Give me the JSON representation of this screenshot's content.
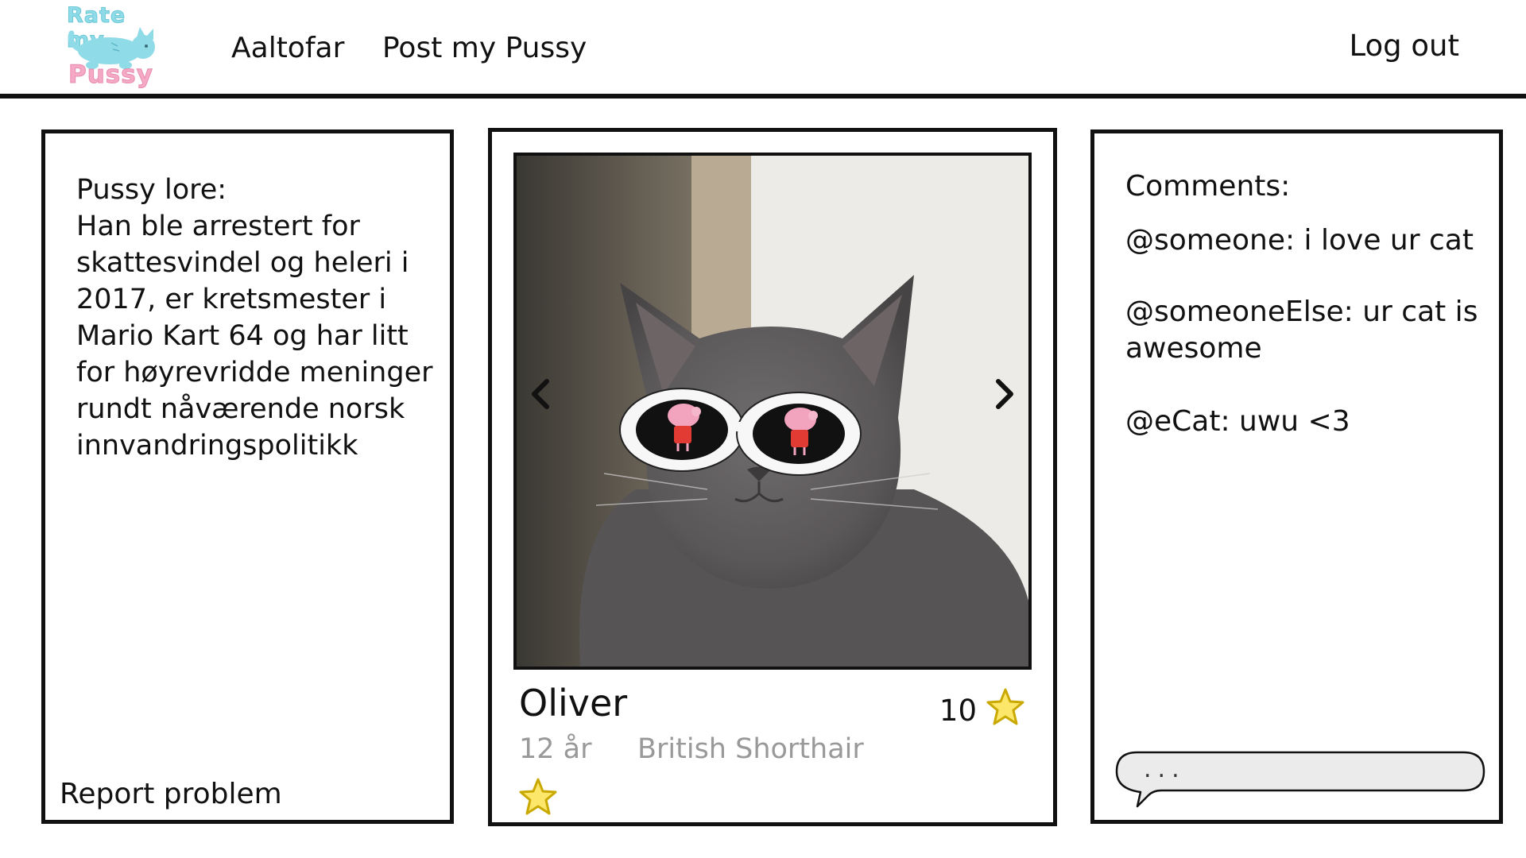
{
  "header": {
    "logo_top": "Rate my",
    "logo_bottom": "Pussy",
    "nav": [
      "Aaltofar",
      "Post my Pussy"
    ],
    "logout": "Log out"
  },
  "lore": {
    "title": "Pussy lore:",
    "text": "Han ble arrestert for skattesvindel og heleri i 2017, er kretsmester i Mario Kart 64 og har litt for høyrevridde meninger rundt nåværende norsk innvandringspolitikk",
    "report": "Report problem"
  },
  "cat": {
    "name": "Oliver",
    "rating": "10",
    "age": "12 år",
    "breed": "British Shorthair"
  },
  "comments": {
    "title": "Comments:",
    "items": [
      "@someone: i love ur cat",
      "@someoneElse: ur cat is awesome",
      "@eCat: uwu <3"
    ],
    "input_placeholder": "..."
  },
  "colors": {
    "star_fill": "#fde76a",
    "star_stroke": "#c9a800",
    "logo_blue": "#8fdbe8",
    "logo_pink": "#f5a9c4"
  },
  "icons": {
    "carousel_prev": "chevron-left-icon",
    "carousel_next": "chevron-right-icon",
    "rating": "star-icon",
    "rate": "star-icon",
    "comment_input": "speech-bubble-icon"
  }
}
